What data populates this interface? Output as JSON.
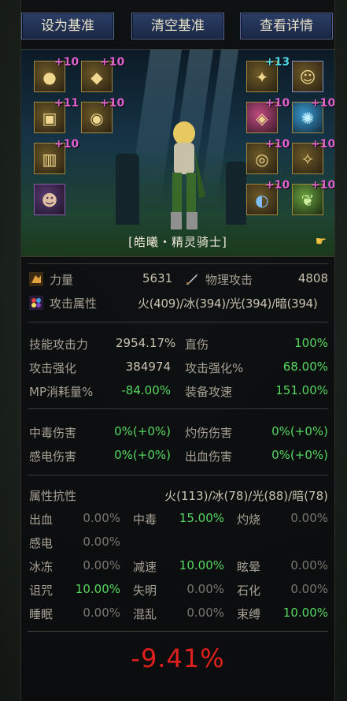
{
  "buttons": {
    "set_baseline": "设为基准",
    "clear_baseline": "清空基准",
    "view_details": "查看详情"
  },
  "equipment": {
    "left": [
      {
        "plus": "+10"
      },
      {
        "plus": "+10"
      },
      {
        "plus": "+11"
      },
      {
        "plus": "+10"
      },
      {
        "plus": "+10"
      }
    ],
    "right": [
      {
        "plus": "+13"
      },
      {
        "plus": ""
      },
      {
        "plus": "+10"
      },
      {
        "plus": "+10"
      },
      {
        "plus": "+10"
      },
      {
        "plus": "+10"
      },
      {
        "plus": "+10"
      },
      {
        "plus": "+10"
      }
    ]
  },
  "character": {
    "name": "[皓曦・精灵骑士]"
  },
  "stats": {
    "strength_label": "力量",
    "strength_value": "5631",
    "phys_atk_label": "物理攻击",
    "phys_atk_value": "4808",
    "element_label": "攻击属性",
    "element_value": "火(409)/冰(394)/光(394)/暗(394)"
  },
  "combat": {
    "skill_atk_label": "技能攻击力",
    "skill_atk_value": "2954.17%",
    "direct_label": "直伤",
    "direct_value": "100%",
    "atk_boost_label": "攻击强化",
    "atk_boost_value": "384974",
    "atk_boost_pct_label": "攻击强化%",
    "atk_boost_pct_value": "68.00%",
    "mp_label": "MP消耗量%",
    "mp_value": "-84.00%",
    "atk_speed_label": "装备攻速",
    "atk_speed_value": "151.00%"
  },
  "dot": {
    "poison_label": "中毒伤害",
    "poison_value": "0%(+0%)",
    "burn_label": "灼伤伤害",
    "burn_value": "0%(+0%)",
    "shock_label": "感电伤害",
    "shock_value": "0%(+0%)",
    "bleed_label": "出血伤害",
    "bleed_value": "0%(+0%)"
  },
  "resist": {
    "title": "属性抗性",
    "title_value": "火(113)/冰(78)/光(88)/暗(78)",
    "rows": [
      [
        {
          "l": "出血",
          "v": "0.00%",
          "g": false
        },
        {
          "l": "中毒",
          "v": "15.00%",
          "g": true
        },
        {
          "l": "灼烧",
          "v": "0.00%",
          "g": false
        }
      ],
      [
        {
          "l": "感电",
          "v": "0.00%",
          "g": false
        }
      ],
      [
        {
          "l": "冰冻",
          "v": "0.00%",
          "g": false
        },
        {
          "l": "减速",
          "v": "10.00%",
          "g": true
        },
        {
          "l": "眩晕",
          "v": "0.00%",
          "g": false
        }
      ],
      [
        {
          "l": "诅咒",
          "v": "10.00%",
          "g": true
        },
        {
          "l": "失明",
          "v": "0.00%",
          "g": false
        },
        {
          "l": "石化",
          "v": "0.00%",
          "g": false
        }
      ],
      [
        {
          "l": "睡眠",
          "v": "0.00%",
          "g": false
        },
        {
          "l": "混乱",
          "v": "0.00%",
          "g": false
        },
        {
          "l": "束缚",
          "v": "10.00%",
          "g": true
        }
      ]
    ]
  },
  "total": "-9.41%",
  "colors": {
    "green": "#55d860",
    "red": "#e0201c",
    "enhance": "#e060d0",
    "enhance_alt": "#50d8e8"
  }
}
